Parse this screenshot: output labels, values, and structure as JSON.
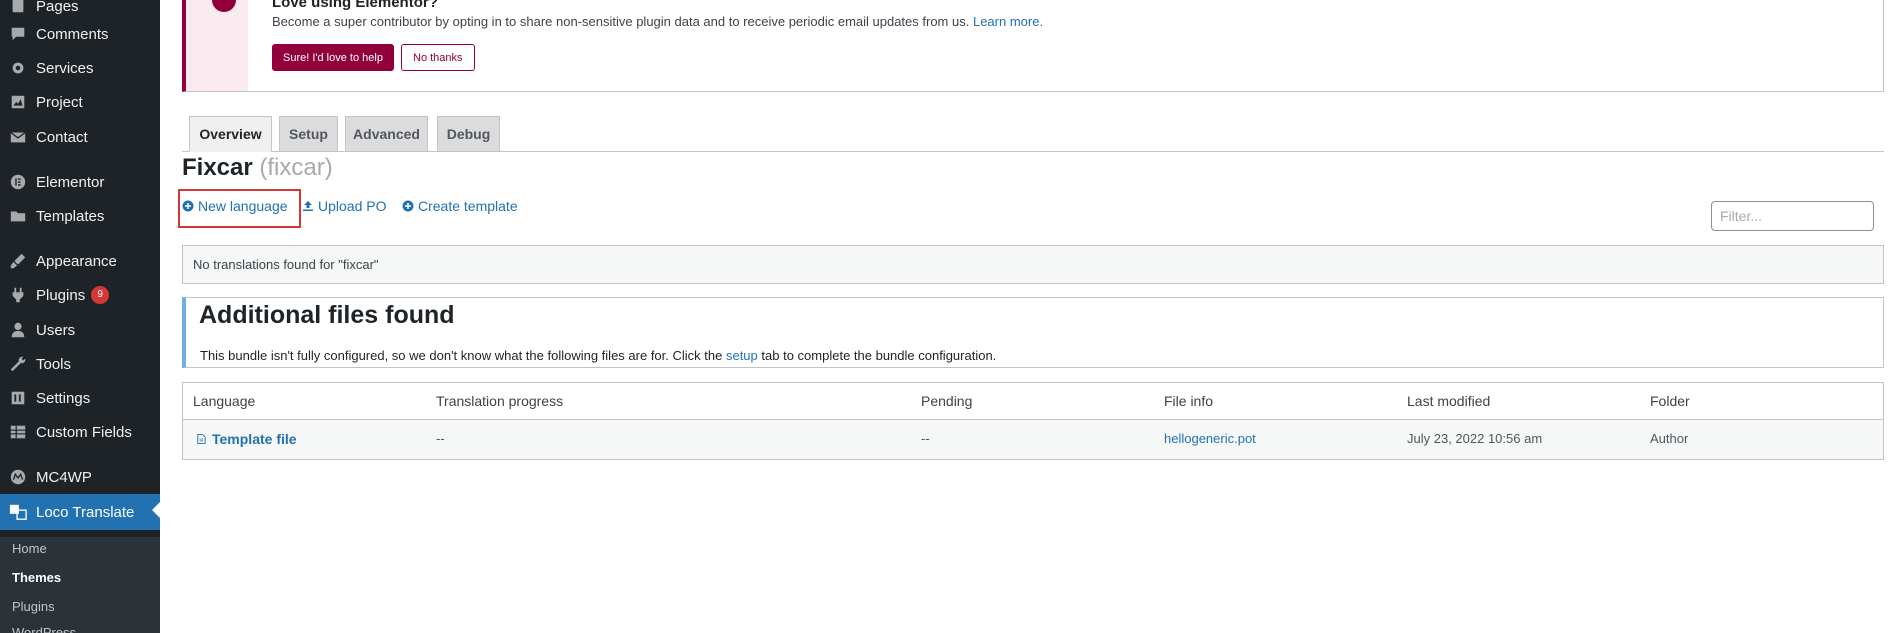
{
  "sidebar": {
    "items": [
      {
        "label": "Pages",
        "icon": "pages-icon"
      },
      {
        "label": "Comments",
        "icon": "comments-icon"
      },
      {
        "label": "Services",
        "icon": "gear-icon"
      },
      {
        "label": "Project",
        "icon": "project-icon"
      },
      {
        "label": "Contact",
        "icon": "mail-icon"
      },
      {
        "label": "Elementor",
        "icon": "elementor-icon"
      },
      {
        "label": "Templates",
        "icon": "folder-icon"
      },
      {
        "label": "Appearance",
        "icon": "brush-icon"
      },
      {
        "label": "Plugins",
        "icon": "plugin-icon",
        "badge": "9"
      },
      {
        "label": "Users",
        "icon": "user-icon"
      },
      {
        "label": "Tools",
        "icon": "wrench-icon"
      },
      {
        "label": "Settings",
        "icon": "settings-icon"
      },
      {
        "label": "Custom Fields",
        "icon": "table-icon"
      },
      {
        "label": "MC4WP",
        "icon": "mc4wp-icon"
      },
      {
        "label": "Loco Translate",
        "icon": "translate-icon"
      }
    ],
    "submenu": [
      "Home",
      "Themes",
      "Plugins",
      "WordPress"
    ]
  },
  "notice": {
    "title": "Love using Elementor?",
    "text": "Become a super contributor by opting in to share non-sensitive plugin data and to receive periodic email updates from us.",
    "link": "Learn more.",
    "primary_button": "Sure! I'd love to help",
    "secondary_button": "No thanks",
    "accent_color": "#92003b"
  },
  "tabs": [
    "Overview",
    "Setup",
    "Advanced",
    "Debug"
  ],
  "header": {
    "title": "Fixcar",
    "slug": "(fixcar)"
  },
  "actions": {
    "new_language": "New language",
    "upload_po": "Upload PO",
    "create_template": "Create template"
  },
  "filter": {
    "placeholder": "Filter..."
  },
  "no_translations": "No translations found for \"fixcar\"",
  "additional": {
    "title": "Additional files found",
    "text_before": "This bundle isn't fully configured, so we don't know what the following files are for. Click the",
    "link": "setup",
    "text_after": "tab to complete the bundle configuration."
  },
  "table": {
    "headers": [
      "Language",
      "Translation progress",
      "Pending",
      "File info",
      "Last modified",
      "Folder"
    ],
    "rows": [
      {
        "language": "Template file",
        "progress": "--",
        "pending": "--",
        "file_info": "hellogeneric.pot",
        "modified": "July 23, 2022 10:56 am",
        "folder": "Author"
      }
    ]
  },
  "colors": {
    "link": "#2271b1",
    "sidebar_bg": "#1d2327",
    "active_menu": "#2271b1",
    "highlight": "#d63638"
  }
}
